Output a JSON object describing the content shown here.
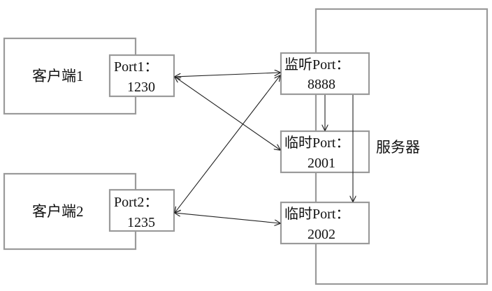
{
  "server": {
    "label": "服务器"
  },
  "clients": [
    {
      "label": "客户端1",
      "port_line1": "Port1：",
      "port_line2": "1230"
    },
    {
      "label": "客户端2",
      "port_line1": "Port2：",
      "port_line2": "1235"
    }
  ],
  "server_ports": [
    {
      "line1": "监听Port：",
      "line2": "8888"
    },
    {
      "line1": "临时Port：",
      "line2": "2001"
    },
    {
      "line1": "临时Port：",
      "line2": "2002"
    }
  ]
}
